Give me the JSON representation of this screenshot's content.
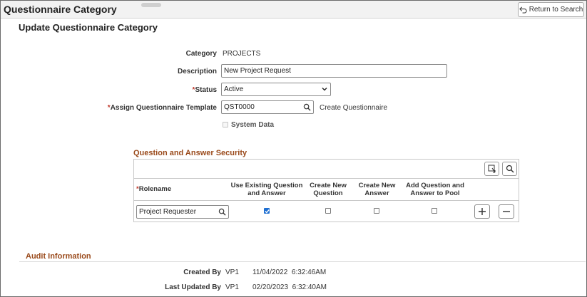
{
  "header": {
    "title": "Questionnaire Category",
    "return_label": "Return to Search"
  },
  "form": {
    "subtitle": "Update Questionnaire Category",
    "category_label": "Category",
    "category_value": "PROJECTS",
    "description_label": "Description",
    "description_value": "New Project Request",
    "status_required_mark": "*",
    "status_label": "Status",
    "status_value": "Active",
    "template_required_mark": "*",
    "template_label": "Assign Questionnaire Template",
    "template_value": "QST0000",
    "create_questionnaire_label": "Create Questionnaire",
    "system_data_label": "System Data",
    "system_data_checked": false
  },
  "security": {
    "title": "Question and Answer Security",
    "columns": {
      "rolename_required_mark": "*",
      "rolename": "Rolename",
      "use_existing": "Use Existing Question and Answer",
      "create_question": "Create New Question",
      "create_answer": "Create New Answer",
      "add_to_pool": "Add Question and Answer to Pool"
    },
    "rows": [
      {
        "rolename": "Project Requester",
        "use_existing": true,
        "create_question": false,
        "create_answer": false,
        "add_to_pool": false
      }
    ],
    "icons": [
      "download-icon",
      "search-icon",
      "plus-icon",
      "minus-icon"
    ]
  },
  "audit": {
    "title": "Audit Information",
    "created_by_label": "Created By",
    "created_by_user": "VP1",
    "created_by_time": "11/04/2022  6:32:46AM",
    "updated_by_label": "Last Updated By",
    "updated_by_user": "VP1",
    "updated_by_time": "02/20/2023  6:32:40AM"
  },
  "colors": {
    "section_title": "#9a4a1b",
    "checkbox_checked": "#1f6fd1",
    "required_mark": "#c0392b"
  }
}
